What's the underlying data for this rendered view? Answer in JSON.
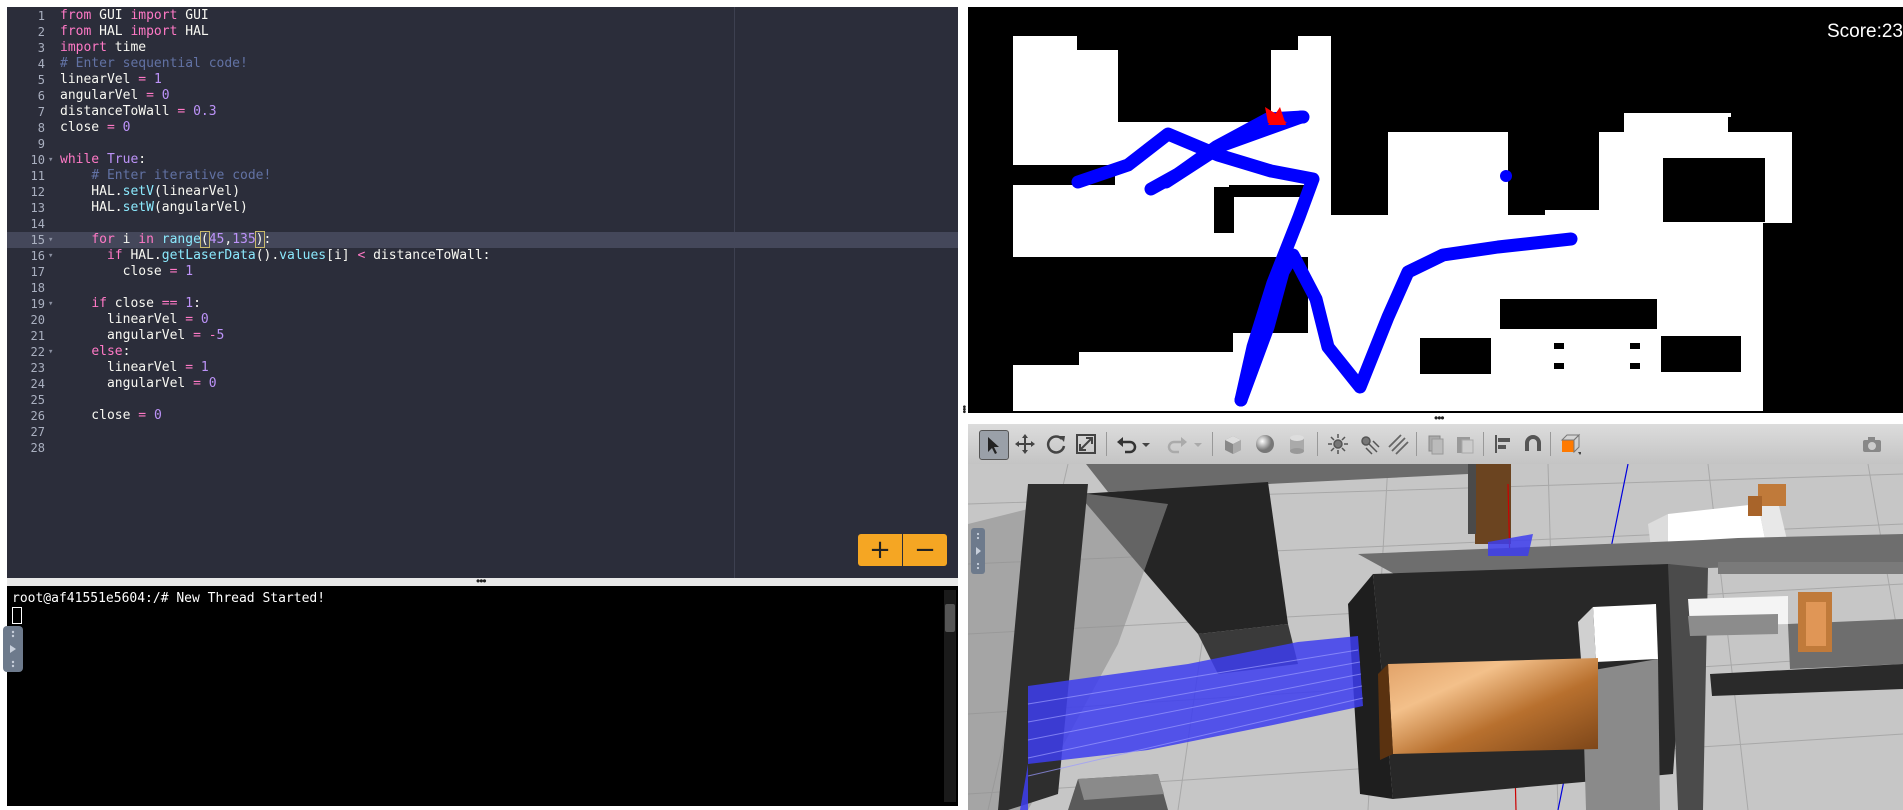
{
  "editor": {
    "active_line": 15,
    "lines": [
      {
        "n": "1",
        "html": "<span class=\"kw\">from</span> GUI <span class=\"kw\">import</span> GUI"
      },
      {
        "n": "2",
        "html": "<span class=\"kw\">from</span> HAL <span class=\"kw\">import</span> HAL"
      },
      {
        "n": "3",
        "html": "<span class=\"kw\">import</span> time"
      },
      {
        "n": "4",
        "html": "<span class=\"cm\"># Enter sequential code!</span>"
      },
      {
        "n": "5",
        "html": "linearVel <span class=\"op\">=</span> <span class=\"num\">1</span>"
      },
      {
        "n": "6",
        "html": "angularVel <span class=\"op\">=</span> <span class=\"num\">0</span>"
      },
      {
        "n": "7",
        "html": "distanceToWall <span class=\"op\">=</span> <span class=\"num\">0.3</span>"
      },
      {
        "n": "8",
        "html": "close <span class=\"op\">=</span> <span class=\"num\">0</span>"
      },
      {
        "n": "9",
        "html": ""
      },
      {
        "n": "10",
        "fold": true,
        "html": "<span class=\"kw\">while</span> <span class=\"bool\">True</span>:"
      },
      {
        "n": "11",
        "html": "    <span class=\"cm\"># Enter iterative code!</span>"
      },
      {
        "n": "12",
        "html": "    HAL.<span class=\"fn\">setV</span>(linearVel)"
      },
      {
        "n": "13",
        "html": "    HAL.<span class=\"fn\">setW</span>(angularVel)"
      },
      {
        "n": "14",
        "html": ""
      },
      {
        "n": "15",
        "fold": true,
        "html": "    <span class=\"kw\">for</span> i <span class=\"kw\">in</span> <span class=\"fn\">range</span><span class=\"brk\">(</span><span class=\"num\">45</span>,<span class=\"num\">135</span><span class=\"brk\">)</span>:"
      },
      {
        "n": "16",
        "fold": true,
        "html": "      <span class=\"kw\">if</span> HAL.<span class=\"fn\">getLaserData</span>().<span class=\"fn\">values</span>[i] <span class=\"op\">&lt;</span> distanceToWall:"
      },
      {
        "n": "17",
        "html": "        close <span class=\"op\">=</span> <span class=\"num\">1</span>"
      },
      {
        "n": "18",
        "html": ""
      },
      {
        "n": "19",
        "fold": true,
        "html": "    <span class=\"kw\">if</span> close <span class=\"op\">==</span> <span class=\"num\">1</span>:"
      },
      {
        "n": "20",
        "html": "      linearVel <span class=\"op\">=</span> <span class=\"num\">0</span>"
      },
      {
        "n": "21",
        "html": "      angularVel <span class=\"op\">=</span> <span class=\"op\">-</span><span class=\"num\">5</span>"
      },
      {
        "n": "22",
        "fold": true,
        "html": "    <span class=\"kw\">else</span>:"
      },
      {
        "n": "23",
        "html": "      linearVel <span class=\"op\">=</span> <span class=\"num\">1</span>"
      },
      {
        "n": "24",
        "html": "      angularVel <span class=\"op\">=</span> <span class=\"num\">0</span>"
      },
      {
        "n": "25",
        "html": ""
      },
      {
        "n": "26",
        "html": "    close <span class=\"op\">=</span> <span class=\"num\">0</span>"
      },
      {
        "n": "27",
        "html": ""
      },
      {
        "n": "28",
        "html": ""
      }
    ],
    "zoom_in_label": "+",
    "zoom_out_label": "−"
  },
  "terminal": {
    "line": "root@af41551e5604:/# New Thread Started!"
  },
  "map": {
    "score": "Score:23",
    "colors": {
      "path": "#0000ff",
      "robot": "#ff0000",
      "wall": "#000000",
      "free": "#ffffff"
    }
  },
  "viewer": {
    "toolbar_icons": [
      "select-arrow-icon",
      "translate-icon",
      "rotate-icon",
      "scale-icon",
      "undo-icon",
      "undo-dropdown-icon",
      "redo-icon",
      "redo-dropdown-icon",
      "box-shape-icon",
      "sphere-shape-icon",
      "cylinder-shape-icon",
      "point-light-icon",
      "spot-light-icon",
      "directional-light-icon",
      "copy-icon",
      "paste-icon",
      "align-icon",
      "magnet-icon",
      "view-angle-icon",
      "screenshot-icon"
    ]
  }
}
